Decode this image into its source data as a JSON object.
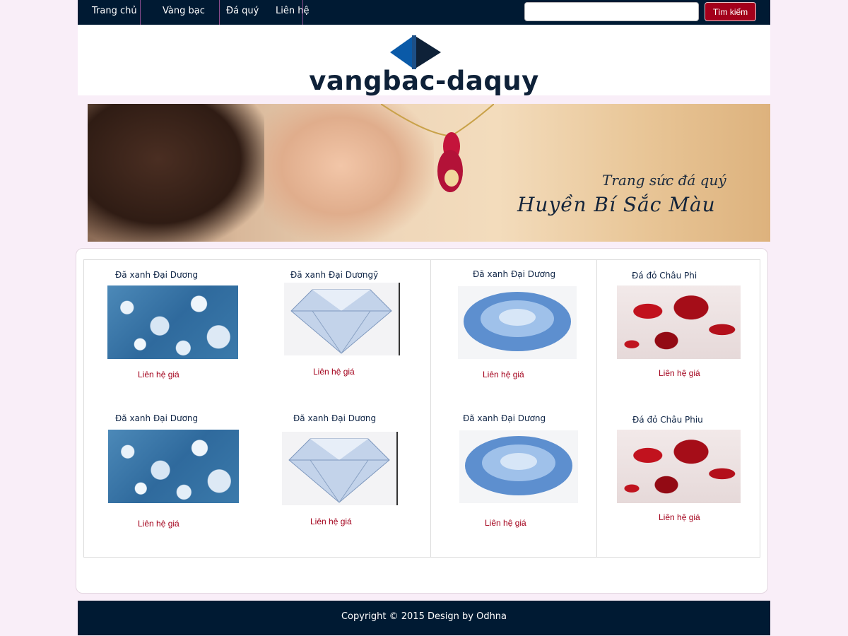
{
  "nav": {
    "items": [
      {
        "label": "Trang chủ"
      },
      {
        "label": "Vàng bạc"
      },
      {
        "label": "Đá quý"
      },
      {
        "label": "Liên hệ"
      }
    ],
    "search": {
      "placeholder": "",
      "value": "",
      "button_label": "Tìm kiếm"
    }
  },
  "logo": {
    "text": "vangbac-daquy"
  },
  "banner": {
    "line1": "Trang sức đá quý",
    "line2": "Huyền Bí Sắc Màu"
  },
  "products": [
    {
      "title": "Đã xanh Đại Dương",
      "price_label": "Liên hệ giá",
      "image": "diamonds-cluster-image"
    },
    {
      "title": "Đã xanh Đại Dươngỹ",
      "price_label": "Liên hệ giá",
      "image": "round-diamond-image"
    },
    {
      "title": "Đã xanh Đại Dương",
      "price_label": "Liên hệ giá",
      "image": "blue-oval-gem-image"
    },
    {
      "title": "Đá đỏ Châu Phi",
      "price_label": "Liên hệ giá",
      "image": "red-heart-gems-image"
    },
    {
      "title": "Đã xanh Đại Dương",
      "price_label": "Liên hệ giá",
      "image": "diamonds-cluster-image"
    },
    {
      "title": "Đã xanh Đại Dương",
      "price_label": "Liên hệ giá",
      "image": "round-diamond-image"
    },
    {
      "title": "Đã xanh Đại Dương",
      "price_label": "Liên hệ giá",
      "image": "blue-oval-gem-image"
    },
    {
      "title": "Đá đỏ Châu Phiu",
      "price_label": "Liên hệ giá",
      "image": "red-heart-gems-image"
    }
  ],
  "footer": {
    "copyright": "Copyright © 2015 Design by Odhna"
  },
  "colors": {
    "nav_bg": "#001a33",
    "accent": "#a3001b",
    "page_bg": "#f9eef8",
    "logo_blue": "#0a5aa8",
    "logo_dark": "#0e2138"
  }
}
